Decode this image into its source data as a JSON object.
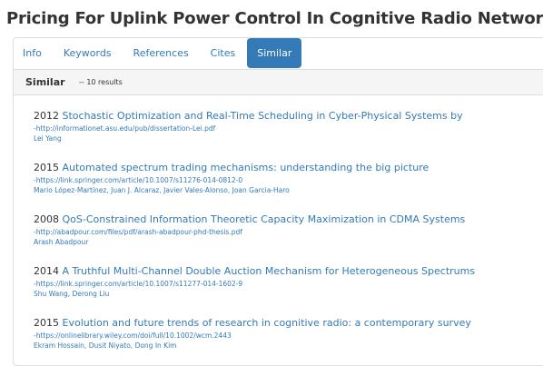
{
  "page": {
    "title": "Pricing For Uplink Power Control In Cognitive Radio Networks"
  },
  "tabs": [
    {
      "label": "Info",
      "active": false
    },
    {
      "label": "Keywords",
      "active": false
    },
    {
      "label": "References",
      "active": false
    },
    {
      "label": "Cites",
      "active": false
    },
    {
      "label": "Similar",
      "active": true
    }
  ],
  "section": {
    "title": "Similar",
    "count": "-- 10 results"
  },
  "results": [
    {
      "year": "2012",
      "title": "Stochastic Optimization and Real-Time Scheduling in Cyber-Physical Systems by",
      "url": "-http://informationet.asu.edu/pub/dissertation-Lei.pdf",
      "authors": "Lei Yang"
    },
    {
      "year": "2015",
      "title": "Automated spectrum trading mechanisms: understanding the big picture",
      "url": "-https://link.springer.com/article/10.1007/s11276-014-0812-0",
      "authors": "Mario López-Martínez, Juan J. Alcaraz, Javier Vales-Alonso, Joan Garcia-Haro"
    },
    {
      "year": "2008",
      "title": "QoS-Constrained Information Theoretic Capacity Maximization in CDMA Systems",
      "url": "-http://abadpour.com/files/pdf/arash-abadpour-phd-thesis.pdf",
      "authors": "Arash Abadpour"
    },
    {
      "year": "2014",
      "title": "A Truthful Multi-Channel Double Auction Mechanism for Heterogeneous Spectrums",
      "url": "-https://link.springer.com/article/10.1007/s11277-014-1602-9",
      "authors": "Shu Wang, Derong Liu"
    },
    {
      "year": "2015",
      "title": "Evolution and future trends of research in cognitive radio: a contemporary survey",
      "url": "-https://onlinelibrary.wiley.com/doi/full/10.1002/wcm.2443",
      "authors": "Ekram Hossain, Dusit Niyato, Dong In Kim"
    }
  ],
  "colors": {
    "link": "#337ab7",
    "active_tab_bg": "#337ab7",
    "subheader_bg": "#f5f5f5",
    "text": "#333333"
  }
}
